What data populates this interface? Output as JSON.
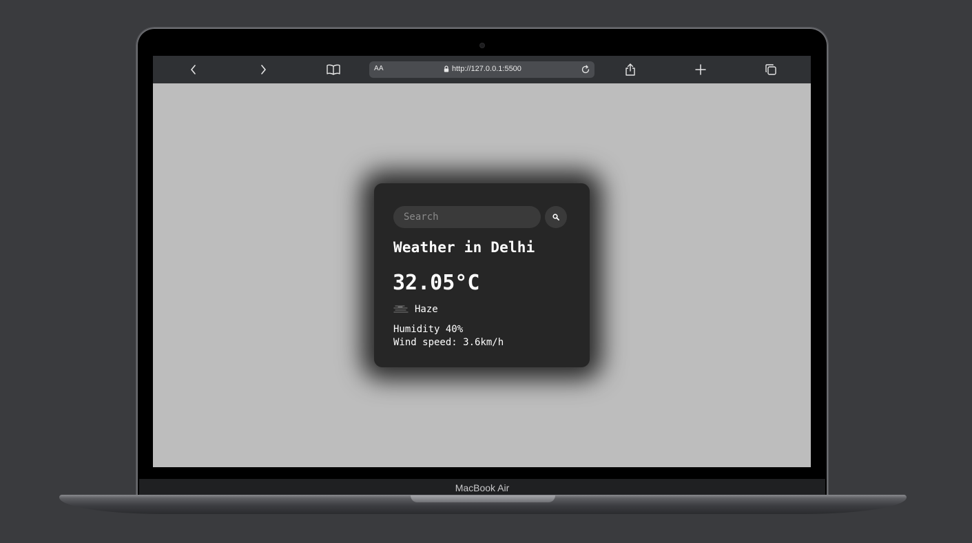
{
  "browser": {
    "reader_label": "AA",
    "url": "http://127.0.0.1:5500"
  },
  "weather": {
    "search_placeholder": "Search",
    "search_value": "",
    "city_title": "Weather in Delhi",
    "temperature": "32.05°C",
    "description": "Haze",
    "humidity": "Humidity 40%",
    "wind": "Wind speed: 3.6km/h",
    "icon": "haze-icon"
  },
  "device": {
    "label": "MacBook Air"
  },
  "colors": {
    "page_background": "#bdbdbd",
    "card_background": "#262626",
    "input_background": "#3a3a3a",
    "toolbar_background": "#2f3134"
  }
}
